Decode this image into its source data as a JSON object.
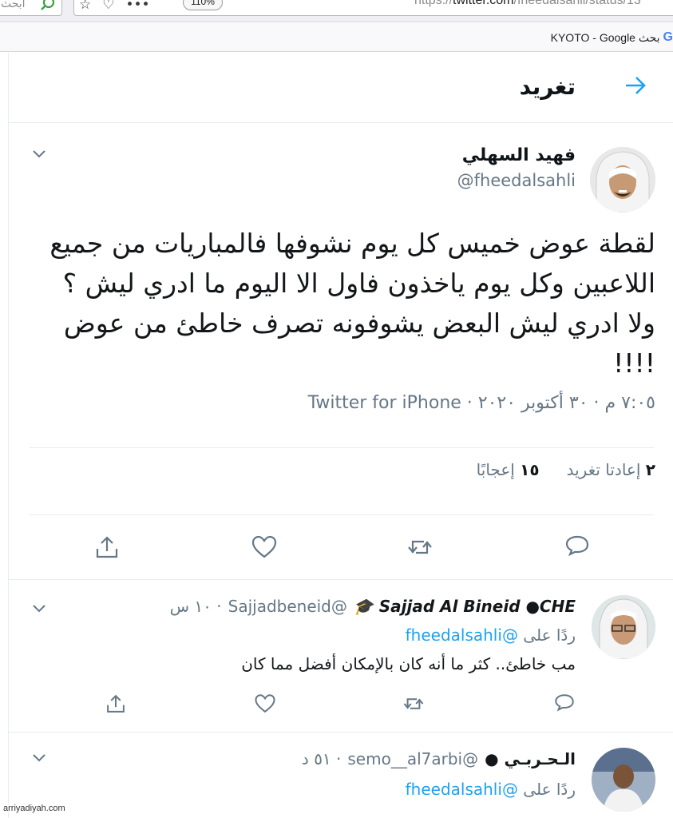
{
  "browser": {
    "search_placeholder": "ابحث",
    "zoom": "110%",
    "url_prefix": "https://",
    "url_domain": "twitter.com",
    "url_path": "/fheedalsahli/status/13",
    "bookmark_g": "G",
    "bookmark_label": "KYOTO - Google بحث"
  },
  "header": {
    "title": "تغريد"
  },
  "tweet": {
    "display_name": "فهيد السهلي",
    "handle": "@fheedalsahli",
    "text": "لقطة عوض خميس كل يوم نشوفها فالمباريات من جميع اللاعبين وكل يوم ياخذون فاول الا اليوم ما ادري ليش ؟ ولا ادري ليش البعض يشوفونه تصرف خاطئ من عوض !!!!",
    "meta": "٧:٠٥ م · ٣٠ أكتوبر ٢٠٢٠ · Twitter for iPhone",
    "retweets_count": "٢",
    "retweets_label": "إعادتا تغريد",
    "likes_count": "١٥",
    "likes_label": "إعجابًا"
  },
  "replies": [
    {
      "display_name": "Sajjad Al Bineid ●CHE 🎓",
      "handle": "@Sajjadbeneid",
      "time": "· ١٠ س",
      "reply_to_prefix": "ردًا على",
      "reply_to_link": "@fheedalsahli",
      "text": "مب خاطئ.. كثر ما أنه كان بالإمكان أفضل مما كان"
    },
    {
      "display_name": "الـحـربـي ●",
      "handle": "@semo__al7arbi",
      "time": "· ٥١ د",
      "reply_to_prefix": "ردًا على",
      "reply_to_link": "@fheedalsahli",
      "text": ""
    }
  ],
  "watermark": "arriyadiyah.com",
  "colors": {
    "accent": "#1da1f2",
    "muted_text": "#657786",
    "border": "#e6ecf0",
    "icon": "#657786"
  }
}
